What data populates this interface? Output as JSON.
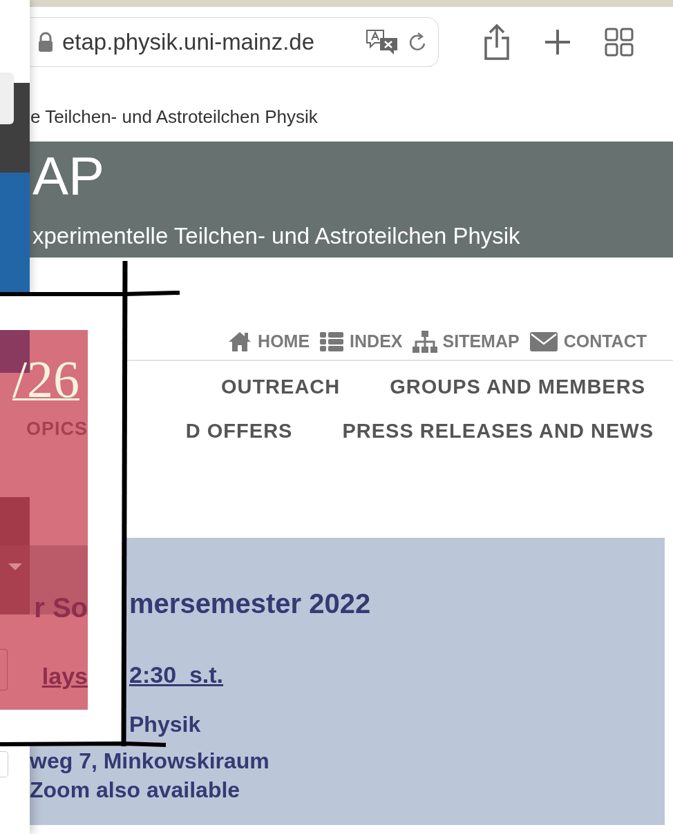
{
  "browser": {
    "url": "etap.physik.uni-mainz.de",
    "tab_title": "e Teilchen- und Astroteilchen Physik"
  },
  "site_header": {
    "logo": "AP",
    "subtitle": "xperimentelle Teilchen- und Astroteilchen Physik"
  },
  "utility_links": [
    {
      "label": "HOME",
      "kind": "home"
    },
    {
      "label": "INDEX",
      "kind": "index"
    },
    {
      "label": "SITEMAP",
      "kind": "sitemap"
    },
    {
      "label": "CONTACT",
      "kind": "contact"
    }
  ],
  "main_menu": [
    {
      "items": [
        "OUTREACH",
        "GROUPS AND MEMBERS"
      ]
    },
    {
      "items": [
        "D OFFERS",
        "PRESS RELEASES AND NEWS"
      ]
    }
  ],
  "announcement": {
    "heading": "mersemester 2022",
    "time": "2:30  s.t.",
    "place": "Physik",
    "address": "weg 7, Minkowskiraum",
    "note": "Zoom also available"
  },
  "overlay_panel": {
    "date": "/26",
    "menu_text": "OPICS",
    "heading": "r So",
    "link": "lays"
  }
}
